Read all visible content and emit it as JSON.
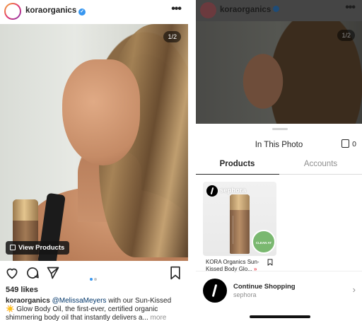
{
  "left": {
    "username": "koraorganics",
    "verified_glyph": "✓",
    "more_glyph": "•••",
    "photo_counter": "1/2",
    "view_products_label": "View Products",
    "likes": "549 likes",
    "caption": {
      "author": "koraorganics",
      "mention": "@MelissaMeyers",
      "text_1": " with our Sun-Kissed",
      "text_2": "☀️ Glow Body Oil, the first-ever, certified organic",
      "text_3": "shimmering body oil that instantly delivers a... ",
      "more": "more"
    },
    "icons": [
      "heart-icon",
      "comment-icon",
      "share-icon",
      "bookmark-icon"
    ]
  },
  "right": {
    "username": "koraorganics",
    "photo_counter": "1/2",
    "sheet_title": "In This Photo",
    "cart_count": "0",
    "tabs": [
      {
        "label": "Products",
        "active": true
      },
      {
        "label": "Accounts",
        "active": false
      }
    ],
    "product": {
      "merchant": "sephora",
      "badge": "CLEAN AT SEPHORA",
      "name_line1": "KORA Organics Sun-",
      "name_line2": "Kissed Body Glo...",
      "arrows": "»"
    },
    "continue": {
      "title": "Continue Shopping",
      "subtitle": "sephora",
      "chevron": "›"
    }
  },
  "colors": {
    "accent_blue": "#3897f0",
    "sale_red": "#ed4956",
    "clean_green": "#7ab870"
  }
}
